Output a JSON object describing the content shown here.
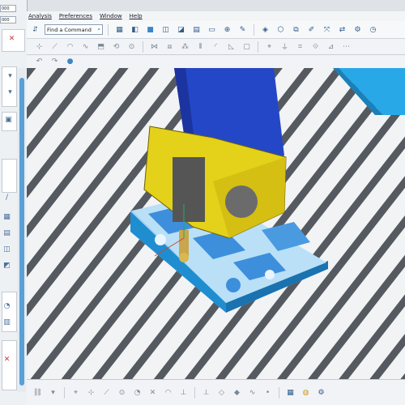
{
  "menu": [
    "Analysis",
    "Preferences",
    "Window",
    "Help"
  ],
  "toolbar": {
    "find_command_label": "Find a Command",
    "find_command_icon": "search-icon"
  },
  "left_panel": {
    "field1": "000",
    "field2": "000"
  }
}
